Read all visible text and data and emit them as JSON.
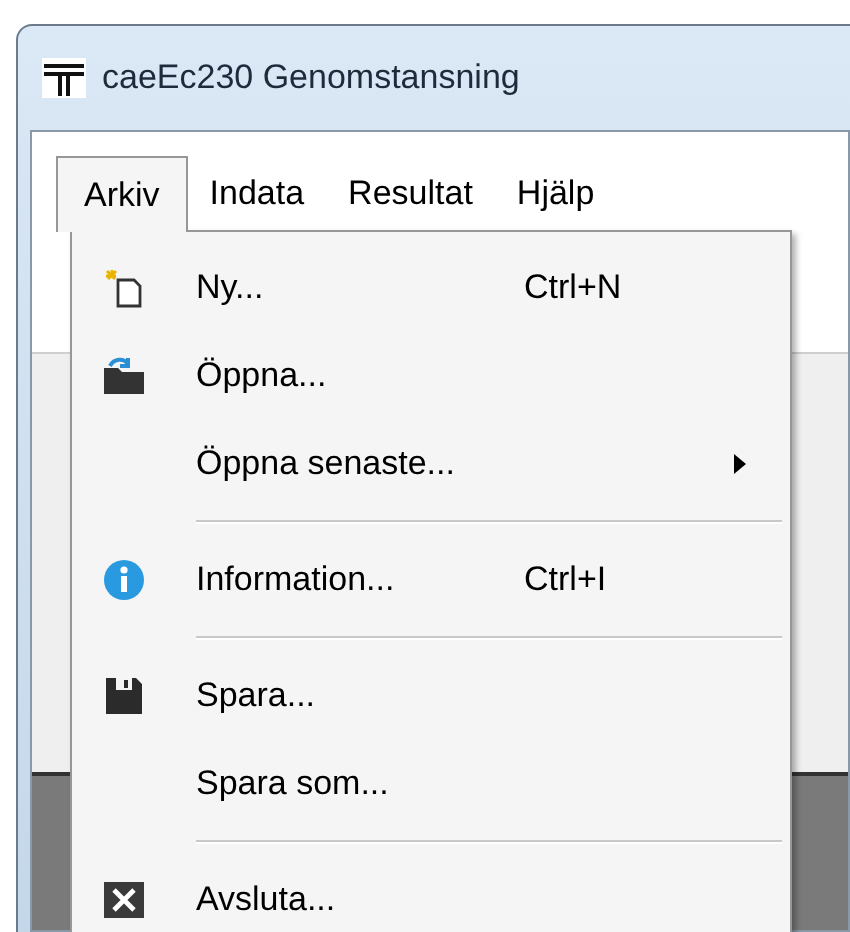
{
  "window": {
    "title": "caeEc230 Genomstansning"
  },
  "menubar": [
    {
      "label": "Arkiv",
      "selected": true
    },
    {
      "label": "Indata",
      "selected": false
    },
    {
      "label": "Resultat",
      "selected": false
    },
    {
      "label": "Hjälp",
      "selected": false
    }
  ],
  "menu": [
    {
      "kind": "item",
      "label": "Ny...",
      "shortcut": "Ctrl+N",
      "submenu": false
    },
    {
      "kind": "item",
      "label": "Öppna...",
      "submenu": false
    },
    {
      "kind": "item",
      "label": "Öppna senaste...",
      "submenu": true
    },
    {
      "kind": "separator"
    },
    {
      "kind": "item",
      "label": "Information...",
      "shortcut": "Ctrl+I",
      "submenu": false
    },
    {
      "kind": "separator"
    },
    {
      "kind": "item",
      "label": "Spara...",
      "submenu": false
    },
    {
      "kind": "item",
      "label": "Spara som...",
      "submenu": false
    },
    {
      "kind": "separator"
    },
    {
      "kind": "item",
      "label": "Avsluta...",
      "submenu": false
    }
  ]
}
